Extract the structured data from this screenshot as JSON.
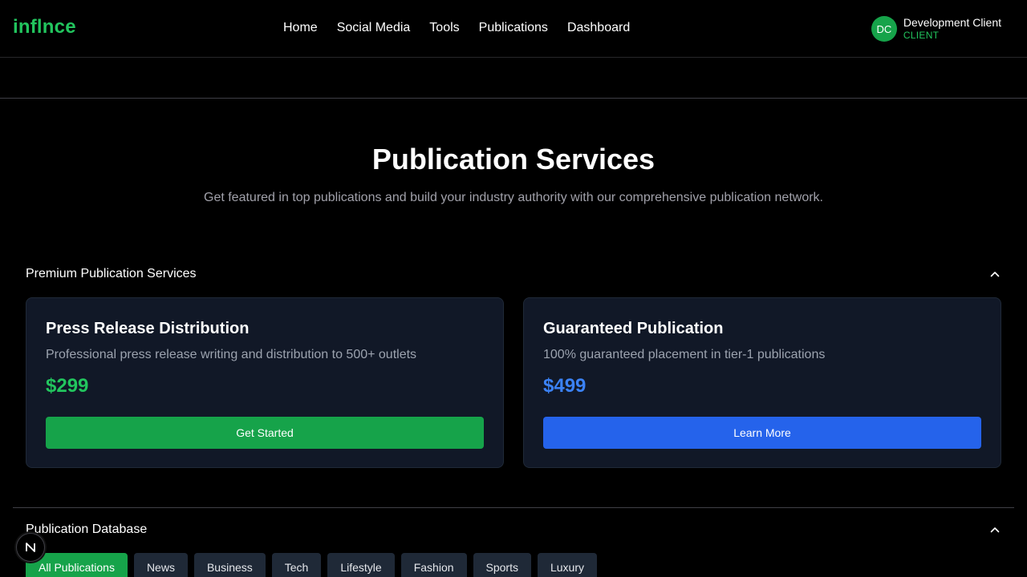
{
  "brand": {
    "logo": "inflnce"
  },
  "nav": {
    "items": [
      "Home",
      "Social Media",
      "Tools",
      "Publications",
      "Dashboard"
    ]
  },
  "user": {
    "initials": "DC",
    "name": "Development Client",
    "role": "CLIENT"
  },
  "hero": {
    "title": "Publication Services",
    "subtitle": "Get featured in top publications and build your industry authority with our comprehensive publication network."
  },
  "premium": {
    "title": "Premium Publication Services",
    "cards": [
      {
        "title": "Press Release Distribution",
        "desc": "Professional press release writing and distribution to 500+ outlets",
        "price": "$299",
        "button": "Get Started",
        "accent": "#22c55e",
        "button_color": "#16a34a"
      },
      {
        "title": "Guaranteed Publication",
        "desc": "100% guaranteed placement in tier-1 publications",
        "price": "$499",
        "button": "Learn More",
        "accent": "#3b82f6",
        "button_color": "#2563eb"
      }
    ]
  },
  "database": {
    "title": "Publication Database",
    "filters": [
      "All Publications",
      "News",
      "Business",
      "Tech",
      "Lifestyle",
      "Fashion",
      "Sports",
      "Luxury"
    ],
    "active_filter": "All Publications"
  },
  "dev_badge": {
    "letter": "N"
  }
}
